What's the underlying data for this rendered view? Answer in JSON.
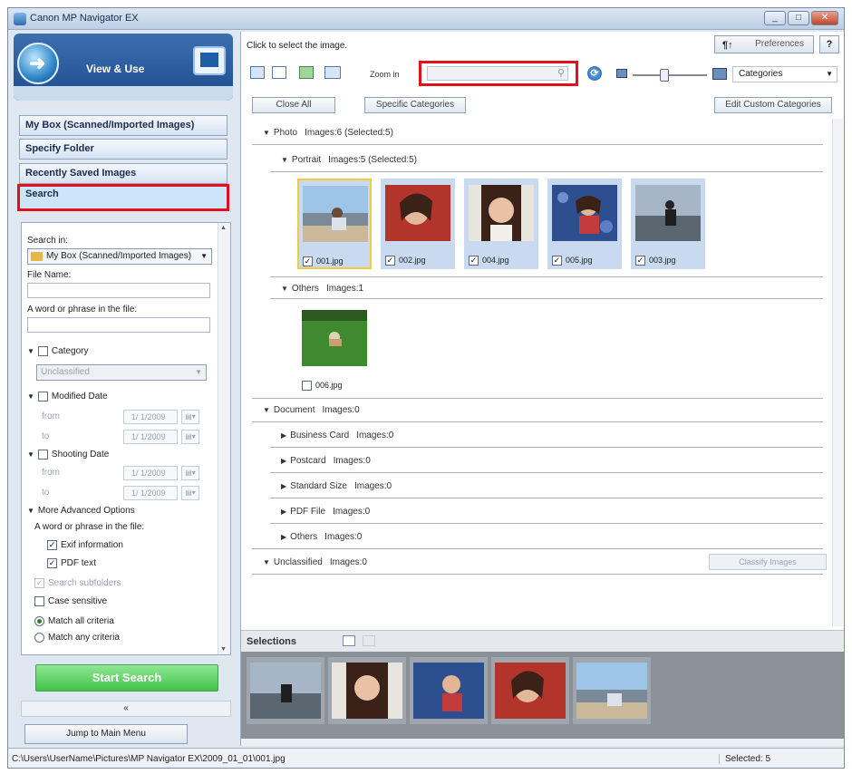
{
  "window": {
    "title": "Canon MP Navigator EX"
  },
  "header": {
    "label": "View & Use"
  },
  "nav": {
    "items": [
      {
        "label": "My Box (Scanned/Imported Images)"
      },
      {
        "label": "Specify Folder"
      },
      {
        "label": "Recently Saved Images"
      },
      {
        "label": "Search",
        "active": true
      }
    ]
  },
  "search_panel": {
    "search_in_label": "Search in:",
    "search_in_value": "My Box (Scanned/Imported Images)",
    "file_name_label": "File Name:",
    "file_name_value": "",
    "word_label": "A word or phrase in the file:",
    "word_value": "",
    "category_label": "Category",
    "category_value": "Unclassified",
    "modified_label": "Modified Date",
    "shooting_label": "Shooting Date",
    "from_label": "from",
    "to_label": "to",
    "date_value": "1/ 1/2009",
    "advanced_label": "More Advanced Options",
    "adv_word_label": "A word or phrase in the file:",
    "exif_label": "Exif information",
    "pdf_label": "PDF text",
    "subfolders_label": "Search subfolders",
    "case_label": "Case sensitive",
    "match_all_label": "Match all criteria",
    "match_any_label": "Match any criteria",
    "start_label": "Start Search",
    "collapse_glyph": "«",
    "jump_label": "Jump to Main Menu"
  },
  "right": {
    "instruction": "Click to select the image.",
    "preferences_label": "Preferences",
    "help_label": "?",
    "zoom_label": "Zoom in",
    "search_value": "",
    "view_select": "Categories",
    "close_all_label": "Close All",
    "specific_categories_label": "Specific Categories",
    "edit_custom_label": "Edit Custom Categories",
    "classify_label": "Classify Images"
  },
  "groups": [
    {
      "name": "Photo",
      "count": "Images:6",
      "selected": "(Selected:5)"
    },
    {
      "name": "Portrait",
      "count": "Images:5",
      "selected": "(Selected:5)"
    },
    {
      "name": "Others",
      "count": "Images:1"
    },
    {
      "name": "Document",
      "count": "Images:0"
    },
    {
      "name": "Business Card",
      "count": "Images:0"
    },
    {
      "name": "Postcard",
      "count": "Images:0"
    },
    {
      "name": "Standard Size",
      "count": "Images:0"
    },
    {
      "name": "PDF File",
      "count": "Images:0"
    },
    {
      "name": "Others",
      "count": "Images:0"
    },
    {
      "name": "Unclassified",
      "count": "Images:0"
    }
  ],
  "thumbnails": [
    {
      "file": "001.jpg",
      "checked": true
    },
    {
      "file": "002.jpg",
      "checked": true
    },
    {
      "file": "004.jpg",
      "checked": true
    },
    {
      "file": "005.jpg",
      "checked": true
    },
    {
      "file": "003.jpg",
      "checked": true
    },
    {
      "file": "006.jpg",
      "checked": false
    }
  ],
  "selections": {
    "label": "Selections"
  },
  "status": {
    "path": "C:\\Users\\UserName\\Pictures\\MP Navigator EX\\2009_01_01\\001.jpg",
    "selected": "Selected: 5"
  },
  "colors": {
    "highlight_red": "#e1101a",
    "start_green": "#43c24a",
    "selection_border": "#f1cb3a"
  }
}
